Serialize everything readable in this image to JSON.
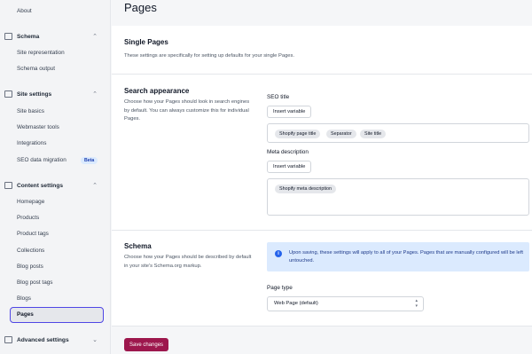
{
  "sidebar": {
    "about": "About",
    "schema": {
      "label": "Schema",
      "items": [
        "Site representation",
        "Schema output"
      ]
    },
    "site_settings": {
      "label": "Site settings",
      "items": [
        "Site basics",
        "Webmaster tools",
        "Integrations",
        "SEO data migration"
      ],
      "beta_badge": "Beta"
    },
    "content_settings": {
      "label": "Content settings",
      "items": [
        "Homepage",
        "Products",
        "Product tags",
        "Collections",
        "Blog posts",
        "Blog post tags",
        "Blogs",
        "Pages"
      ]
    },
    "advanced_settings": {
      "label": "Advanced settings"
    },
    "active_item": "Pages"
  },
  "main": {
    "title": "Pages",
    "single": {
      "title": "Single Pages",
      "desc": "These settings are specifically for setting up defaults for your single Pages."
    },
    "search": {
      "title": "Search appearance",
      "desc": "Choose how your Pages should look in search engines by default. You can always customize this for individual Pages.",
      "seo_title_label": "SEO title",
      "insert_variable": "Insert variable",
      "seo_tags": [
        "Shopify page title",
        "Separator",
        "Site title"
      ],
      "meta_label": "Meta description",
      "meta_tags": [
        "Shopify meta description"
      ]
    },
    "schema": {
      "title": "Schema",
      "desc": "Choose how your Pages should be described by default in your site's Schema.org markup.",
      "info": "Upon saving, these settings will apply to all of your Pages. Pages that are manually configured will be left untouched.",
      "page_type_label": "Page type",
      "page_type_value": "Web Page (default)"
    },
    "save_label": "Save changes"
  },
  "colors": {
    "primary": "#9d174d",
    "focus": "#4f46e5",
    "info_bg": "#dbeafe"
  },
  "icons": [
    "schema-icon",
    "site-settings-icon",
    "content-settings-icon",
    "advanced-settings-icon",
    "info-icon",
    "chevron-up-icon",
    "chevron-down-icon",
    "select-arrows-icon"
  ]
}
